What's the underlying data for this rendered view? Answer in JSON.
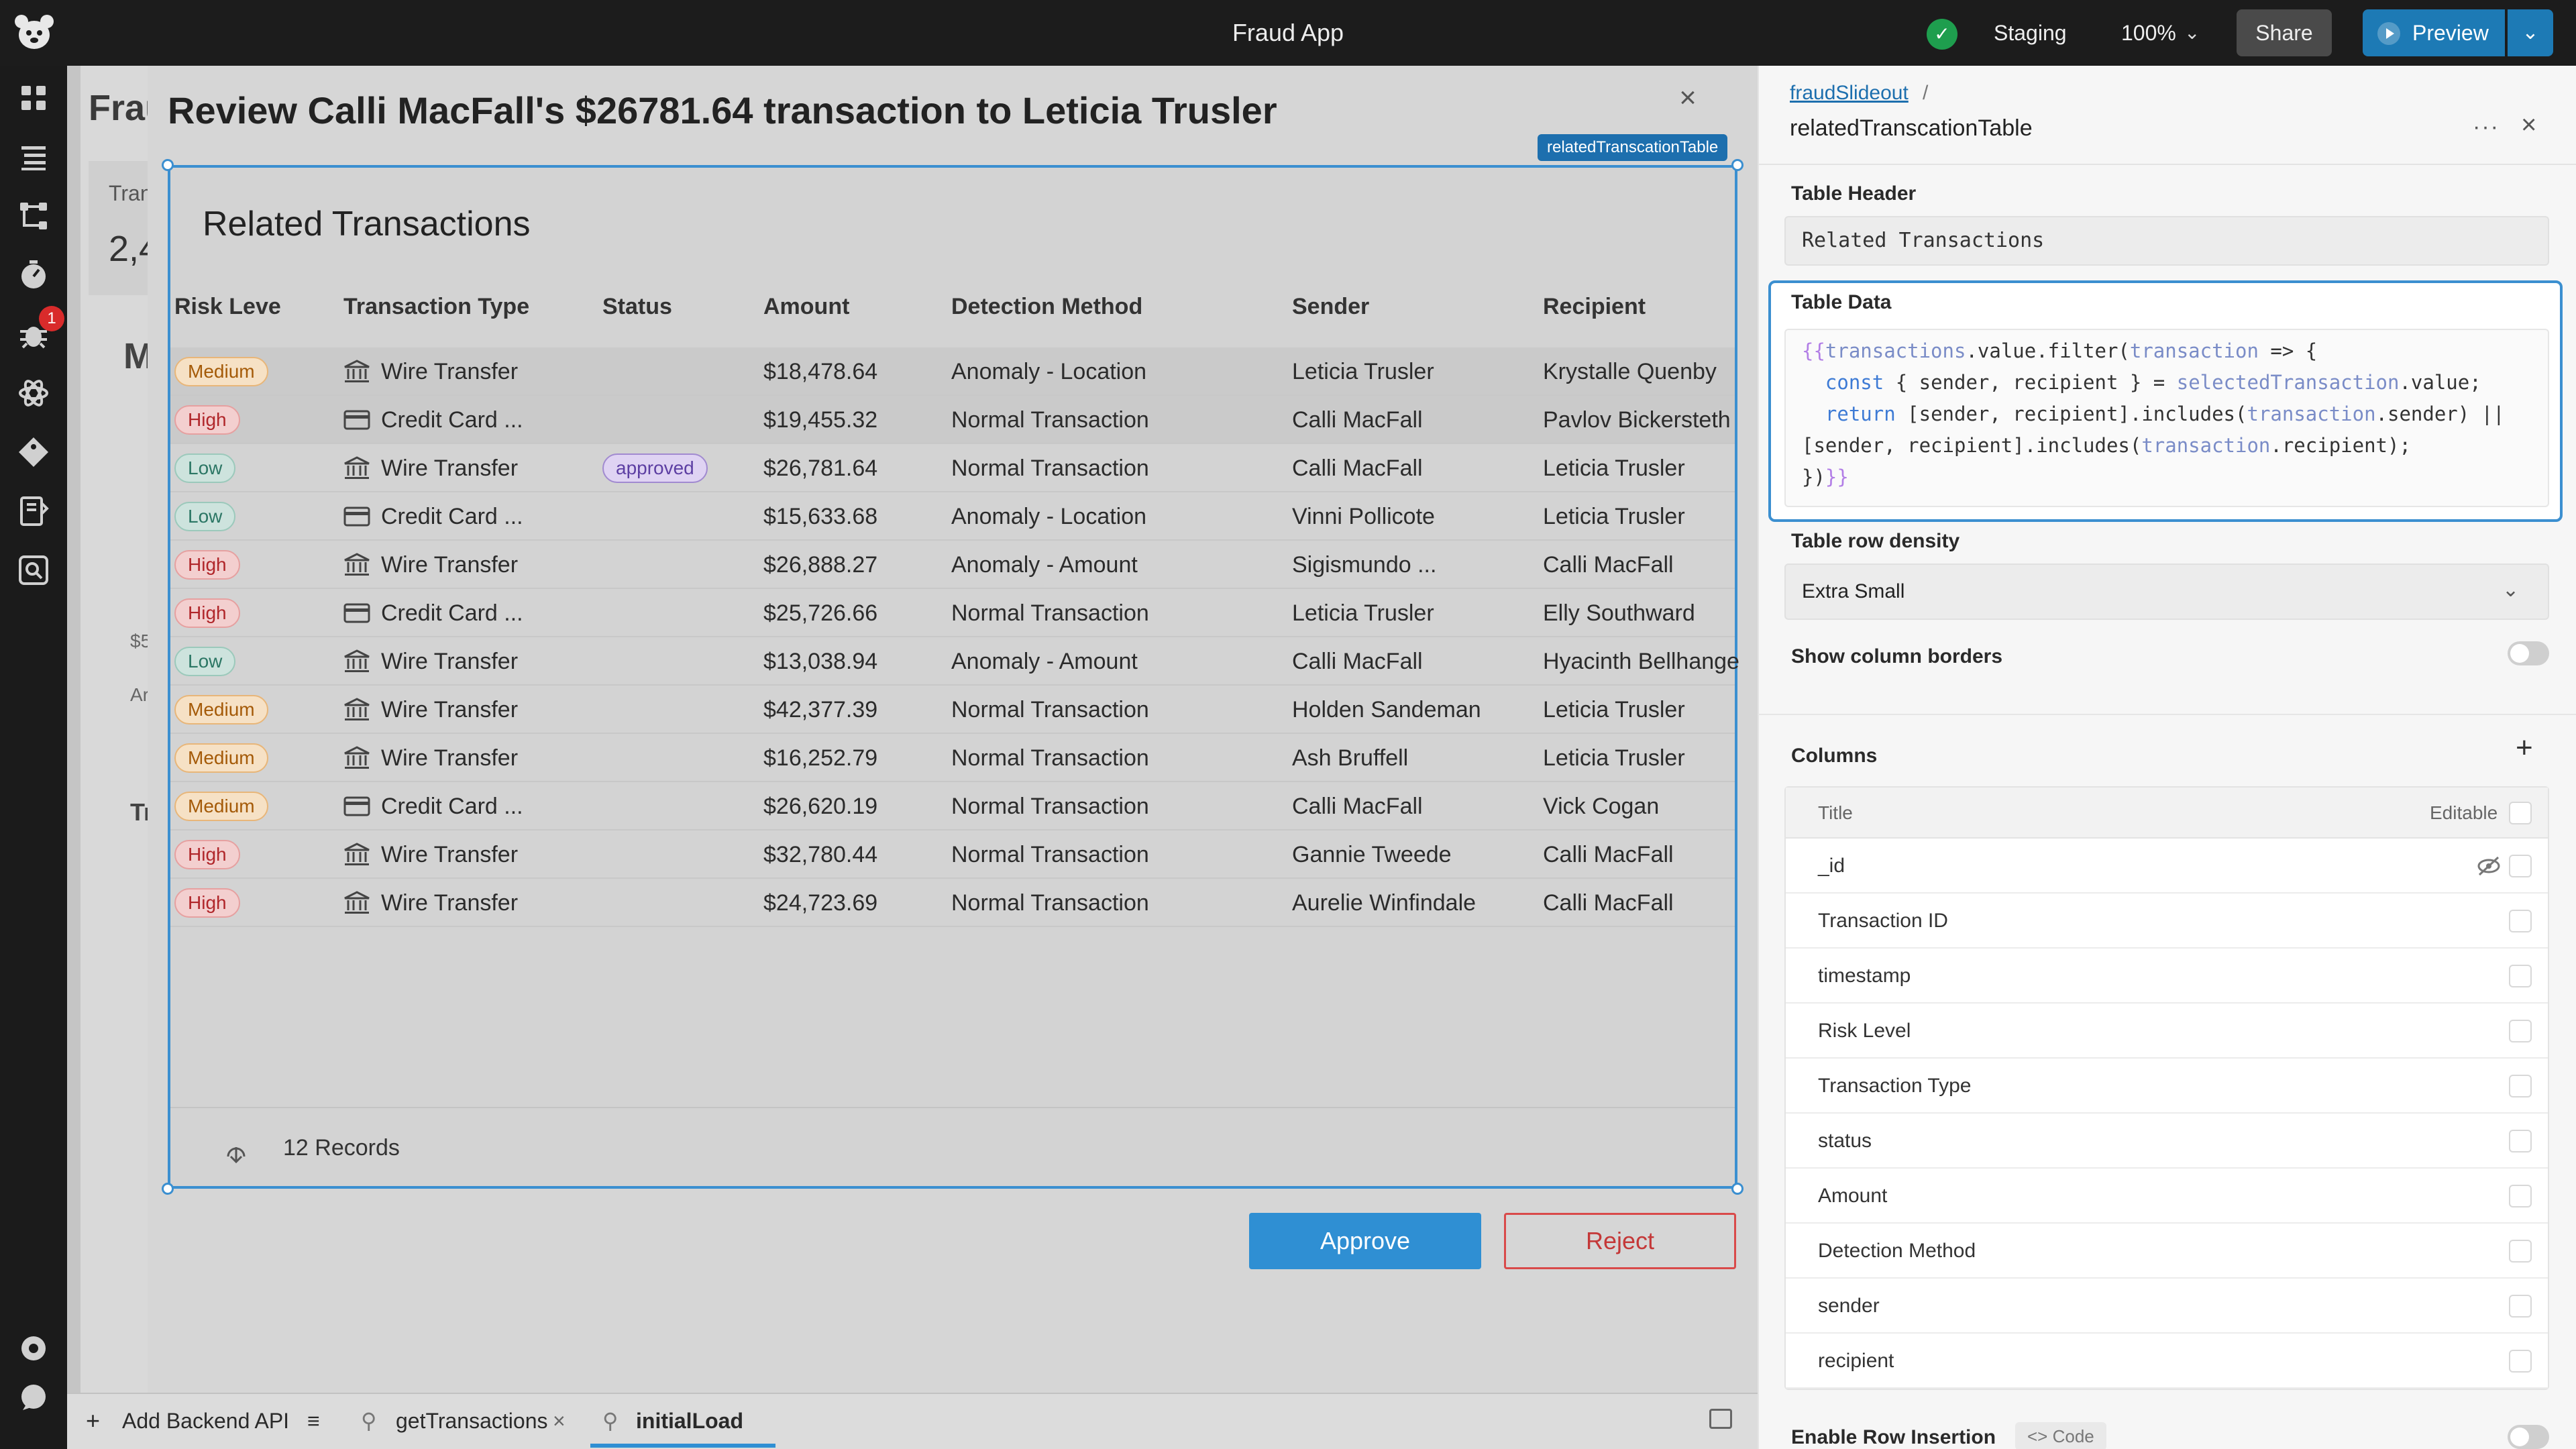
{
  "topbar": {
    "app_title": "Fraud App",
    "env_label": "Staging",
    "zoom_label": "100%",
    "share_label": "Share",
    "preview_label": "Preview"
  },
  "nav": {
    "notification_count": "1",
    "icons": [
      "apps-icon",
      "layers-icon",
      "workflow-icon",
      "gauge-icon",
      "bug-icon",
      "atom-icon",
      "tag-icon",
      "book-icon",
      "search-doc-icon",
      "settings-icon",
      "chat-icon"
    ]
  },
  "background_app": {
    "title_fragment": "Frau",
    "card_label_fragment": "Tran",
    "card_value_fragment": "2,4",
    "heading_fragment": "M",
    "s_fragment": "$5",
    "a_fragment": "Ar",
    "tr_fragment": "Tr"
  },
  "modal": {
    "title": "Review Calli MacFall's $26781.64 transaction to Leticia Trusler",
    "component_tag": "relatedTranscationTable",
    "table_header": "Related Transactions",
    "columns": [
      "Risk Leve",
      "Transaction Type",
      "Status",
      "Amount",
      "Detection Method",
      "Sender",
      "Recipient"
    ],
    "rows": [
      {
        "risk": "Medium",
        "type": "Wire Transfer",
        "status": "",
        "amount": "$18,478.64",
        "method": "Anomaly - Location",
        "sender": "Leticia Trusler",
        "recipient": "Krystalle Quenby"
      },
      {
        "risk": "High",
        "type": "Credit Card ...",
        "status": "",
        "amount": "$19,455.32",
        "method": "Normal Transaction",
        "sender": "Calli MacFall",
        "recipient": "Pavlov Bickersteth"
      },
      {
        "risk": "Low",
        "type": "Wire Transfer",
        "status": "approved",
        "amount": "$26,781.64",
        "method": "Normal Transaction",
        "sender": "Calli MacFall",
        "recipient": "Leticia Trusler"
      },
      {
        "risk": "Low",
        "type": "Credit Card ...",
        "status": "",
        "amount": "$15,633.68",
        "method": "Anomaly - Location",
        "sender": "Vinni Pollicote",
        "recipient": "Leticia Trusler"
      },
      {
        "risk": "High",
        "type": "Wire Transfer",
        "status": "",
        "amount": "$26,888.27",
        "method": "Anomaly - Amount",
        "sender": "Sigismundo ...",
        "recipient": "Calli MacFall"
      },
      {
        "risk": "High",
        "type": "Credit Card ...",
        "status": "",
        "amount": "$25,726.66",
        "method": "Normal Transaction",
        "sender": "Leticia Trusler",
        "recipient": "Elly Southward"
      },
      {
        "risk": "Low",
        "type": "Wire Transfer",
        "status": "",
        "amount": "$13,038.94",
        "method": "Anomaly - Amount",
        "sender": "Calli MacFall",
        "recipient": "Hyacinth Bellhange"
      },
      {
        "risk": "Medium",
        "type": "Wire Transfer",
        "status": "",
        "amount": "$42,377.39",
        "method": "Normal Transaction",
        "sender": "Holden Sandeman",
        "recipient": "Leticia Trusler"
      },
      {
        "risk": "Medium",
        "type": "Wire Transfer",
        "status": "",
        "amount": "$16,252.79",
        "method": "Normal Transaction",
        "sender": "Ash Bruffell",
        "recipient": "Leticia Trusler"
      },
      {
        "risk": "Medium",
        "type": "Credit Card ...",
        "status": "",
        "amount": "$26,620.19",
        "method": "Normal Transaction",
        "sender": "Calli MacFall",
        "recipient": "Vick Cogan"
      },
      {
        "risk": "High",
        "type": "Wire Transfer",
        "status": "",
        "amount": "$32,780.44",
        "method": "Normal Transaction",
        "sender": "Gannie Tweede",
        "recipient": "Calli MacFall"
      },
      {
        "risk": "High",
        "type": "Wire Transfer",
        "status": "",
        "amount": "$24,723.69",
        "method": "Normal Transaction",
        "sender": "Aurelie Winfindale",
        "recipient": "Calli MacFall"
      }
    ],
    "records_label": "12 Records",
    "approve_label": "Approve",
    "reject_label": "Reject"
  },
  "bottombar": {
    "add_api_label": "Add Backend API",
    "tab_1": "getTransactions",
    "tab_2": "initialLoad"
  },
  "inspector": {
    "breadcrumb_parent": "fraudSlideout",
    "breadcrumb_sep": "/",
    "component_name": "relatedTranscationTable",
    "table_header_label": "Table Header",
    "table_header_value": "Related Transactions",
    "table_data_label": "Table Data",
    "table_data_code": [
      "{{transactions.value.filter(transaction => {",
      "  const { sender, recipient } = selectedTransaction.value;",
      "  return [sender, recipient].includes(transaction.sender) ||",
      "[sender, recipient].includes(transaction.recipient);",
      "})}}"
    ],
    "density_label": "Table row density",
    "density_value": "Extra Small",
    "borders_label": "Show column borders",
    "borders_on": false,
    "columns_label": "Columns",
    "columns_head_title": "Title",
    "columns_head_editable": "Editable",
    "columns": [
      "_id",
      "Transaction ID",
      "timestamp",
      "Risk Level",
      "Transaction Type",
      "status",
      "Amount",
      "Detection Method",
      "sender",
      "recipient"
    ],
    "row_insertion_label": "Enable Row Insertion",
    "code_chip_label": "Code"
  },
  "colors": {
    "accent": "#2f8fd3",
    "reject": "#d94a4a",
    "topbar": "#1c1c1c"
  }
}
